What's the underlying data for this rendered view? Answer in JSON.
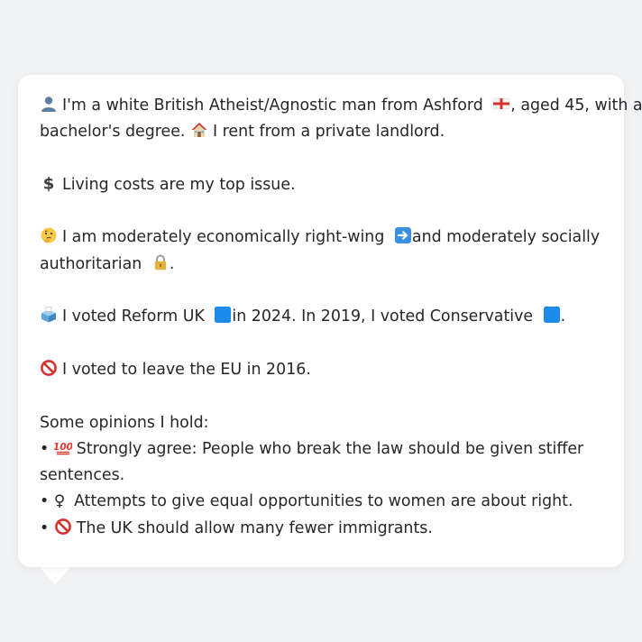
{
  "profile": {
    "intro_line1": "I'm a white British Atheist/Agnostic man from Ashford",
    "intro_line1_tail": ", aged 45, with a",
    "intro_line2_start": "bachelor's degree.",
    "intro_line2_end": "I rent from a private landlord.",
    "top_issue": "Living costs are my top issue.",
    "ideology_line1_start": "I am moderately economically right-wing",
    "ideology_line1_end": "and moderately socially",
    "ideology_line2": "authoritarian",
    "ideology_line2_tail": ".",
    "vote_2024": "I voted Reform UK",
    "vote_2019": "in 2024. In 2019, I voted Conservative",
    "vote_tail": ".",
    "brexit": "I voted to leave the EU in 2016.",
    "opinions_heading": "Some opinions I hold:",
    "bullet": "•",
    "opinion1_line1": "Strongly agree: People who break the law should be given stiffer",
    "opinion1_line2": "sentences.",
    "opinion2_symbol": "♀",
    "opinion2": "Attempts to give equal opportunities to women are about right.",
    "opinion3": "The UK should allow many fewer immigrants."
  },
  "colors": {
    "background": "#f1f2f4",
    "bubble": "#ffffff",
    "text": "#26262b",
    "reform_blue": "#1d8bea",
    "conservative_blue": "#1d8bea",
    "no_red": "#d8322e"
  },
  "icons": {
    "person": "person-silhouette-icon",
    "england_flag": "england-flag-icon",
    "house": "house-icon",
    "dollar": "dollar-sign-icon",
    "thinking": "thinking-face-icon",
    "right_arrow": "right-arrow-icon",
    "lock": "lock-icon",
    "ballot": "ballot-box-icon",
    "blue_square": "blue-square-icon",
    "prohibited": "prohibited-icon",
    "hundred": "hundred-points-icon",
    "female": "female-sign-icon"
  }
}
